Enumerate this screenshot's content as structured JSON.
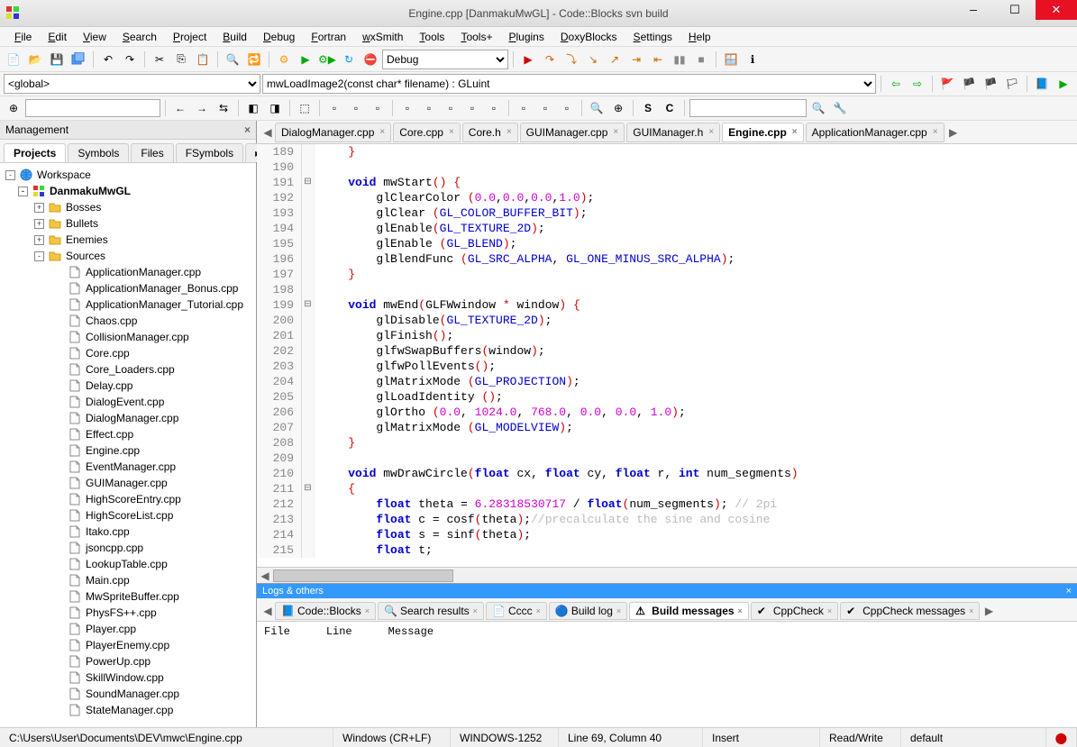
{
  "window": {
    "title": "Engine.cpp [DanmakuMwGL] - Code::Blocks svn build"
  },
  "menu": [
    "File",
    "Edit",
    "View",
    "Search",
    "Project",
    "Build",
    "Debug",
    "Fortran",
    "wxSmith",
    "Tools",
    "Tools+",
    "Plugins",
    "DoxyBlocks",
    "Settings",
    "Help"
  ],
  "toolbar": {
    "config": "Debug"
  },
  "symbol_bar": {
    "scope": "<global>",
    "function": "mwLoadImage2(const char* filename) : GLuint"
  },
  "management": {
    "title": "Management",
    "tabs": [
      "Projects",
      "Symbols",
      "Files",
      "FSymbols"
    ],
    "tree": {
      "workspace": "Workspace",
      "project": "DanmakuMwGL",
      "folders": [
        "Bosses",
        "Bullets",
        "Enemies",
        "Sources"
      ],
      "sources": [
        "ApplicationManager.cpp",
        "ApplicationManager_Bonus.cpp",
        "ApplicationManager_Tutorial.cpp",
        "Chaos.cpp",
        "CollisionManager.cpp",
        "Core.cpp",
        "Core_Loaders.cpp",
        "Delay.cpp",
        "DialogEvent.cpp",
        "DialogManager.cpp",
        "Effect.cpp",
        "Engine.cpp",
        "EventManager.cpp",
        "GUIManager.cpp",
        "HighScoreEntry.cpp",
        "HighScoreList.cpp",
        "Itako.cpp",
        "jsoncpp.cpp",
        "LookupTable.cpp",
        "Main.cpp",
        "MwSpriteBuffer.cpp",
        "PhysFS++.cpp",
        "Player.cpp",
        "PlayerEnemy.cpp",
        "PowerUp.cpp",
        "SkillWindow.cpp",
        "SoundManager.cpp",
        "StateManager.cpp"
      ]
    }
  },
  "editor_tabs": [
    "DialogManager.cpp",
    "Core.cpp",
    "Core.h",
    "GUIManager.cpp",
    "GUIManager.h",
    "Engine.cpp",
    "ApplicationManager.cpp"
  ],
  "editor_active": "Engine.cpp",
  "code": {
    "lines": [
      {
        "n": 189,
        "fold": "",
        "html": "    <span class='paren'>}</span>"
      },
      {
        "n": 190,
        "fold": "",
        "html": ""
      },
      {
        "n": 191,
        "fold": "⊟",
        "html": "    <span class='kw'>void</span> mwStart<span class='paren'>()</span> <span class='paren'>{</span>"
      },
      {
        "n": 192,
        "fold": "",
        "html": "        glClearColor <span class='paren'>(</span><span class='num'>0.0</span>,<span class='num'>0.0</span>,<span class='num'>0.0</span>,<span class='num'>1.0</span><span class='paren'>)</span>;"
      },
      {
        "n": 193,
        "fold": "",
        "html": "        glClear <span class='paren'>(</span><span class='const'>GL_COLOR_BUFFER_BIT</span><span class='paren'>)</span>;"
      },
      {
        "n": 194,
        "fold": "",
        "html": "        glEnable<span class='paren'>(</span><span class='const'>GL_TEXTURE_2D</span><span class='paren'>)</span>;"
      },
      {
        "n": 195,
        "fold": "",
        "html": "        glEnable <span class='paren'>(</span><span class='const'>GL_BLEND</span><span class='paren'>)</span>;"
      },
      {
        "n": 196,
        "fold": "",
        "html": "        glBlendFunc <span class='paren'>(</span><span class='const'>GL_SRC_ALPHA</span>, <span class='const'>GL_ONE_MINUS_SRC_ALPHA</span><span class='paren'>)</span>;"
      },
      {
        "n": 197,
        "fold": "",
        "html": "    <span class='paren'>}</span>"
      },
      {
        "n": 198,
        "fold": "",
        "html": ""
      },
      {
        "n": 199,
        "fold": "⊟",
        "html": "    <span class='kw'>void</span> mwEnd<span class='paren'>(</span>GLFWwindow <span class='paren'>*</span> window<span class='paren'>)</span> <span class='paren'>{</span>"
      },
      {
        "n": 200,
        "fold": "",
        "html": "        glDisable<span class='paren'>(</span><span class='const'>GL_TEXTURE_2D</span><span class='paren'>)</span>;"
      },
      {
        "n": 201,
        "fold": "",
        "html": "        glFinish<span class='paren'>()</span>;"
      },
      {
        "n": 202,
        "fold": "",
        "html": "        glfwSwapBuffers<span class='paren'>(</span>window<span class='paren'>)</span>;"
      },
      {
        "n": 203,
        "fold": "",
        "html": "        glfwPollEvents<span class='paren'>()</span>;"
      },
      {
        "n": 204,
        "fold": "",
        "html": "        glMatrixMode <span class='paren'>(</span><span class='const'>GL_PROJECTION</span><span class='paren'>)</span>;"
      },
      {
        "n": 205,
        "fold": "",
        "html": "        glLoadIdentity <span class='paren'>()</span>;"
      },
      {
        "n": 206,
        "fold": "",
        "html": "        glOrtho <span class='paren'>(</span><span class='num'>0.0</span>, <span class='num'>1024.0</span>, <span class='num'>768.0</span>, <span class='num'>0.0</span>, <span class='num'>0.0</span>, <span class='num'>1.0</span><span class='paren'>)</span>;"
      },
      {
        "n": 207,
        "fold": "",
        "html": "        glMatrixMode <span class='paren'>(</span><span class='const'>GL_MODELVIEW</span><span class='paren'>)</span>;"
      },
      {
        "n": 208,
        "fold": "",
        "html": "    <span class='paren'>}</span>"
      },
      {
        "n": 209,
        "fold": "",
        "html": ""
      },
      {
        "n": 210,
        "fold": "",
        "html": "    <span class='kw'>void</span> mwDrawCircle<span class='paren'>(</span><span class='kw'>float</span> cx, <span class='kw'>float</span> cy, <span class='kw'>float</span> r, <span class='kw'>int</span> num_segments<span class='paren'>)</span>"
      },
      {
        "n": 211,
        "fold": "⊟",
        "html": "    <span class='paren'>{</span>"
      },
      {
        "n": 212,
        "fold": "",
        "html": "        <span class='kw'>float</span> theta = <span class='num'>6.28318530717</span> / <span class='kw'>float</span><span class='paren'>(</span>num_segments<span class='paren'>)</span>; <span class='cmt'>// 2pi</span>"
      },
      {
        "n": 213,
        "fold": "",
        "html": "        <span class='kw'>float</span> c = cosf<span class='paren'>(</span>theta<span class='paren'>)</span>;<span class='cmt'>//precalculate the sine and cosine</span>"
      },
      {
        "n": 214,
        "fold": "",
        "html": "        <span class='kw'>float</span> s = sinf<span class='paren'>(</span>theta<span class='paren'>)</span>;"
      },
      {
        "n": 215,
        "fold": "",
        "html": "        <span class='kw'>float</span> t;"
      }
    ]
  },
  "logs": {
    "title": "Logs & others",
    "tabs": [
      "Code::Blocks",
      "Search results",
      "Cccc",
      "Build log",
      "Build messages",
      "CppCheck",
      "CppCheck messages"
    ],
    "active": "Build messages",
    "cols": [
      "File",
      "Line",
      "Message"
    ]
  },
  "status": {
    "path": "C:\\Users\\User\\Documents\\DEV\\mwc\\Engine.cpp",
    "eol": "Windows (CR+LF)",
    "encoding": "WINDOWS-1252",
    "pos": "Line 69, Column 40",
    "mode": "Insert",
    "rw": "Read/Write",
    "profile": "default"
  }
}
